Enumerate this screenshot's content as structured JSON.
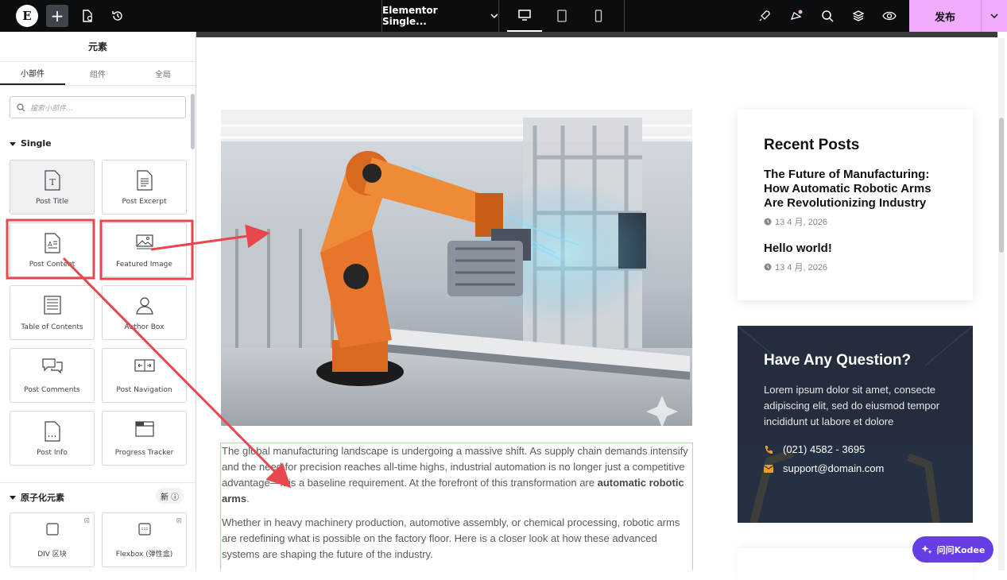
{
  "topbar": {
    "logo": "E",
    "add": "+",
    "document_title": "Elementor Single...",
    "publish_label": "发布"
  },
  "panel": {
    "title": "元素",
    "tabs": [
      "小部件",
      "组件",
      "全局"
    ],
    "search_placeholder": "搜索小部件...",
    "category_single": "Single",
    "single_widgets": [
      "Post Title",
      "Post Excerpt",
      "Post Content",
      "Featured Image",
      "Table of Contents",
      "Author Box",
      "Post Comments",
      "Post Navigation",
      "Post Info",
      "Progress Tracker"
    ],
    "category_atomic": "原子化元素",
    "new_badge": "新 ⓘ",
    "atomic_widgets": [
      "DIV 区块",
      "Flexbox (弹性盒)"
    ]
  },
  "post": {
    "p1_start": "The global manufacturing landscape is undergoing a massive shift. As supply chain demands intensify and the need for precision reaches all-time highs, industrial automation is no longer just a competitive advantage—it is a baseline requirement. At the forefront of this transformation are ",
    "p1_bold": "automatic robotic arms",
    "p1_end": ".",
    "p2": "Whether in heavy machinery production, automotive assembly, or chemical processing, robotic arms are redefining what is possible on the factory floor. Here is a closer look at how these advanced systems are shaping the future of the industry."
  },
  "sidebar": {
    "recent_title": "Recent Posts",
    "posts": [
      {
        "title": "The Future of Manufacturing: How Automatic Robotic Arms Are Revolutionizing Industry",
        "date": "13 4 月, 2026"
      },
      {
        "title": "Hello world!",
        "date": "13 4 月, 2026"
      }
    ],
    "question_title": "Have Any Question?",
    "question_desc": "Lorem ipsum dolor sit amet, consecte adipiscing elit, sed do eiusmod tempor incididunt ut labore et dolore",
    "phone": "(021) 4582 - 3695",
    "email": "support@domain.com"
  },
  "assistant": {
    "label": "问问Kodee"
  },
  "colors": {
    "accent": "#f0abfc",
    "annotation": "#e8474f",
    "question_bg": "#2b3645",
    "icon_orange": "#f39c2d",
    "kodee": "#673de6"
  }
}
